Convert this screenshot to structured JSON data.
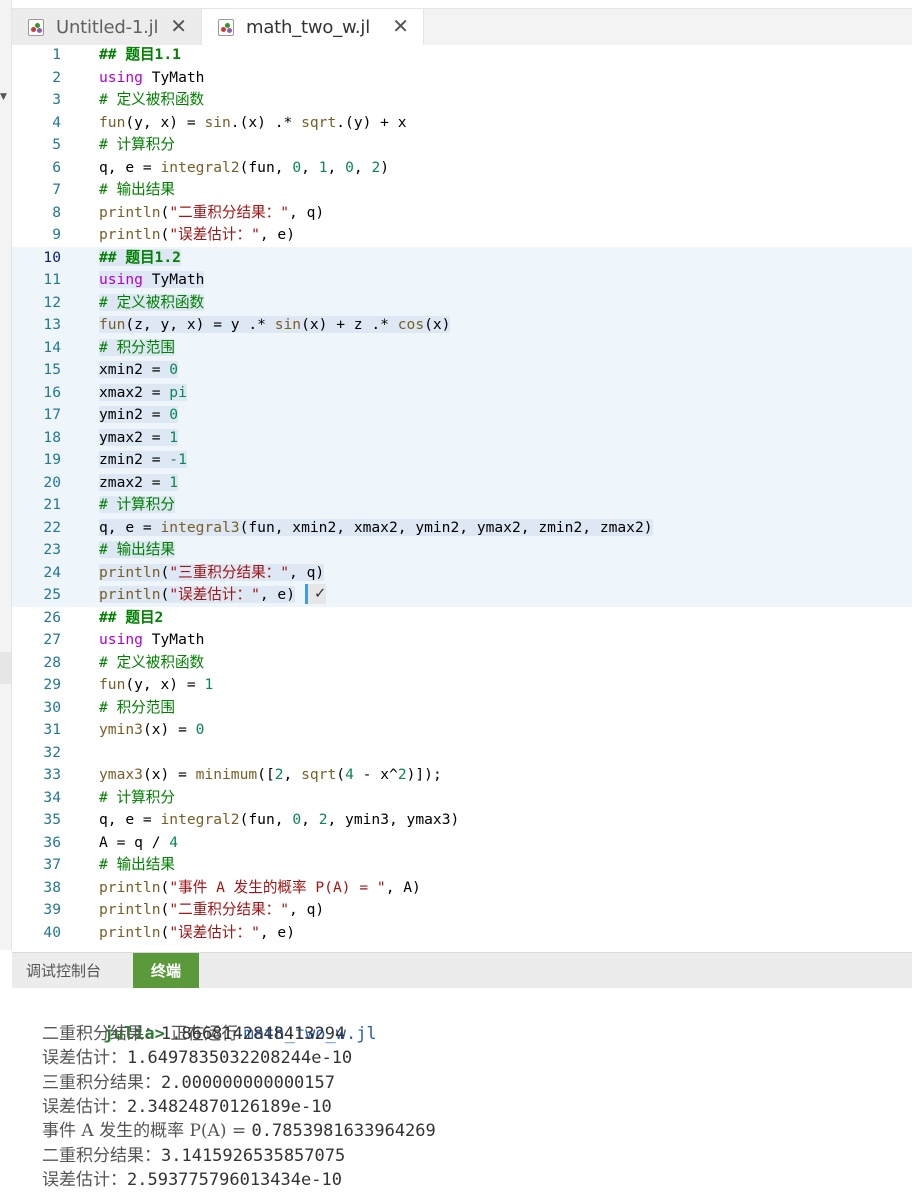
{
  "tabs": [
    {
      "label": "Untitled-1.jl",
      "close": "✕"
    },
    {
      "label": "math_two_w.jl",
      "close": "✕"
    }
  ],
  "editor": {
    "lines": [
      {
        "n": "1",
        "tokens": [
          [
            "hd",
            "## 题目1.1"
          ]
        ]
      },
      {
        "n": "2",
        "tokens": [
          [
            "kw",
            "using"
          ],
          [
            "pl",
            " TyMath"
          ]
        ]
      },
      {
        "n": "3",
        "tokens": [
          [
            "cm",
            "# 定义被积函数"
          ]
        ]
      },
      {
        "n": "4",
        "tokens": [
          [
            "fn",
            "fun"
          ],
          [
            "pl",
            "(y, x) = "
          ],
          [
            "fn",
            "sin"
          ],
          [
            "pl",
            ".(x) .* "
          ],
          [
            "fn",
            "sqrt"
          ],
          [
            "pl",
            ".(y) + x"
          ]
        ]
      },
      {
        "n": "5",
        "tokens": [
          [
            "cm",
            "# 计算积分"
          ]
        ]
      },
      {
        "n": "6",
        "tokens": [
          [
            "pl",
            "q, e = "
          ],
          [
            "fn",
            "integral2"
          ],
          [
            "pl",
            "(fun, "
          ],
          [
            "nm",
            "0"
          ],
          [
            "pl",
            ", "
          ],
          [
            "nm",
            "1"
          ],
          [
            "pl",
            ", "
          ],
          [
            "nm",
            "0"
          ],
          [
            "pl",
            ", "
          ],
          [
            "nm",
            "2"
          ],
          [
            "pl",
            ")"
          ]
        ]
      },
      {
        "n": "7",
        "tokens": [
          [
            "cm",
            "# 输出结果"
          ]
        ]
      },
      {
        "n": "8",
        "tokens": [
          [
            "fn",
            "println"
          ],
          [
            "pl",
            "("
          ],
          [
            "st",
            "\"二重积分结果：\""
          ],
          [
            "pl",
            ", q)"
          ]
        ]
      },
      {
        "n": "9",
        "tokens": [
          [
            "fn",
            "println"
          ],
          [
            "pl",
            "("
          ],
          [
            "st",
            "\"误差估计：\""
          ],
          [
            "pl",
            ", e)"
          ]
        ]
      },
      {
        "n": "10",
        "tokens": [
          [
            "hd",
            "## 题目1.2"
          ]
        ],
        "sel": true
      },
      {
        "n": "11",
        "tokens": [
          [
            "kw",
            "using"
          ],
          [
            "pl",
            " TyMath"
          ]
        ],
        "sel": true
      },
      {
        "n": "12",
        "tokens": [
          [
            "cm",
            "# 定义被积函数"
          ]
        ],
        "sel": true
      },
      {
        "n": "13",
        "tokens": [
          [
            "fn",
            "fun"
          ],
          [
            "pl",
            "(z, y, x) = y .* "
          ],
          [
            "fn",
            "sin"
          ],
          [
            "pl",
            "(x) + z .* "
          ],
          [
            "fn",
            "cos"
          ],
          [
            "pl",
            "(x)"
          ]
        ],
        "sel": true
      },
      {
        "n": "14",
        "tokens": [
          [
            "cm",
            "# 积分范围"
          ]
        ],
        "sel": true
      },
      {
        "n": "15",
        "tokens": [
          [
            "pl",
            "xmin2 = "
          ],
          [
            "nm",
            "0"
          ]
        ],
        "sel": true
      },
      {
        "n": "16",
        "tokens": [
          [
            "pl",
            "xmax2 = "
          ],
          [
            "nm",
            "pi"
          ]
        ],
        "sel": true
      },
      {
        "n": "17",
        "tokens": [
          [
            "pl",
            "ymin2 = "
          ],
          [
            "nm",
            "0"
          ]
        ],
        "sel": true
      },
      {
        "n": "18",
        "tokens": [
          [
            "pl",
            "ymax2 = "
          ],
          [
            "nm",
            "1"
          ]
        ],
        "sel": true
      },
      {
        "n": "19",
        "tokens": [
          [
            "pl",
            "zmin2 = "
          ],
          [
            "nm",
            "-1"
          ]
        ],
        "sel": true
      },
      {
        "n": "20",
        "tokens": [
          [
            "pl",
            "zmax2 = "
          ],
          [
            "nm",
            "1"
          ]
        ],
        "sel": true
      },
      {
        "n": "21",
        "tokens": [
          [
            "cm",
            "# 计算积分"
          ]
        ],
        "sel": true
      },
      {
        "n": "22",
        "tokens": [
          [
            "pl",
            "q, e = "
          ],
          [
            "fn",
            "integral3"
          ],
          [
            "pl",
            "(fun, xmin2, xmax2, ymin2, ymax2, zmin2, zmax2)"
          ]
        ],
        "sel": true
      },
      {
        "n": "23",
        "tokens": [
          [
            "cm",
            "# 输出结果"
          ]
        ],
        "sel": true
      },
      {
        "n": "24",
        "tokens": [
          [
            "fn",
            "println"
          ],
          [
            "pl",
            "("
          ],
          [
            "st",
            "\"三重积分结果：\""
          ],
          [
            "pl",
            ", q)"
          ]
        ],
        "sel": true
      },
      {
        "n": "25",
        "tokens": [
          [
            "fn",
            "println"
          ],
          [
            "pl",
            "("
          ],
          [
            "st",
            "\"误差估计：\""
          ],
          [
            "pl",
            ", e)"
          ]
        ],
        "sel": true,
        "check": "✓"
      },
      {
        "n": "26",
        "tokens": [
          [
            "hd",
            "## 题目2"
          ]
        ]
      },
      {
        "n": "27",
        "tokens": [
          [
            "kw",
            "using"
          ],
          [
            "pl",
            " TyMath"
          ]
        ]
      },
      {
        "n": "28",
        "tokens": [
          [
            "cm",
            "# 定义被积函数"
          ]
        ]
      },
      {
        "n": "29",
        "tokens": [
          [
            "fn",
            "fun"
          ],
          [
            "pl",
            "(y, x) = "
          ],
          [
            "nm",
            "1"
          ]
        ]
      },
      {
        "n": "30",
        "tokens": [
          [
            "cm",
            "# 积分范围"
          ]
        ]
      },
      {
        "n": "31",
        "tokens": [
          [
            "fn",
            "ymin3"
          ],
          [
            "pl",
            "(x) = "
          ],
          [
            "nm",
            "0"
          ]
        ]
      },
      {
        "n": "32",
        "tokens": []
      },
      {
        "n": "33",
        "tokens": [
          [
            "fn",
            "ymax3"
          ],
          [
            "pl",
            "(x) = "
          ],
          [
            "fn",
            "minimum"
          ],
          [
            "pl",
            "(["
          ],
          [
            "nm",
            "2"
          ],
          [
            "pl",
            ", "
          ],
          [
            "fn",
            "sqrt"
          ],
          [
            "pl",
            "("
          ],
          [
            "nm",
            "4"
          ],
          [
            "pl",
            " - x^"
          ],
          [
            "nm",
            "2"
          ],
          [
            "pl",
            ")]);"
          ]
        ]
      },
      {
        "n": "34",
        "tokens": [
          [
            "cm",
            "# 计算积分"
          ]
        ]
      },
      {
        "n": "35",
        "tokens": [
          [
            "pl",
            "q, e = "
          ],
          [
            "fn",
            "integral2"
          ],
          [
            "pl",
            "(fun, "
          ],
          [
            "nm",
            "0"
          ],
          [
            "pl",
            ", "
          ],
          [
            "nm",
            "2"
          ],
          [
            "pl",
            ", ymin3, ymax3)"
          ]
        ]
      },
      {
        "n": "36",
        "tokens": [
          [
            "pl",
            "A = q / "
          ],
          [
            "nm",
            "4"
          ]
        ]
      },
      {
        "n": "37",
        "tokens": [
          [
            "cm",
            "# 输出结果"
          ]
        ]
      },
      {
        "n": "38",
        "tokens": [
          [
            "fn",
            "println"
          ],
          [
            "pl",
            "("
          ],
          [
            "st",
            "\"事件 A 发生的概率 P(A) = \""
          ],
          [
            "pl",
            ", A)"
          ]
        ]
      },
      {
        "n": "39",
        "tokens": [
          [
            "fn",
            "println"
          ],
          [
            "pl",
            "("
          ],
          [
            "st",
            "\"二重积分结果：\""
          ],
          [
            "pl",
            ", q)"
          ]
        ]
      },
      {
        "n": "40",
        "tokens": [
          [
            "fn",
            "println"
          ],
          [
            "pl",
            "("
          ],
          [
            "st",
            "\"误差估计：\""
          ],
          [
            "pl",
            ", e)"
          ]
        ]
      }
    ]
  },
  "panel": {
    "debug_tab": "调试控制台",
    "terminal_tab": "终端"
  },
  "terminal": {
    "prompt": "julia>",
    "running_text": " 正在运行 ",
    "running_file": "math_two_w.jl",
    "output": [
      {
        "label": "二重积分结果：",
        "value": "1.8668142848413294"
      },
      {
        "label": "误差估计：",
        "value": "1.6497835032208244e-10"
      },
      {
        "label": "三重积分结果：",
        "value": "2.000000000000157"
      },
      {
        "label": "误差估计：",
        "value": "2.34824870126189e-10"
      },
      {
        "label": "事件 A 发生的概率 P(A) = ",
        "value": "0.7853981633964269"
      },
      {
        "label": "二重积分结果：",
        "value": "3.1415926535857075"
      },
      {
        "label": "误差估计：",
        "value": "2.593775796013434e-10"
      }
    ]
  }
}
